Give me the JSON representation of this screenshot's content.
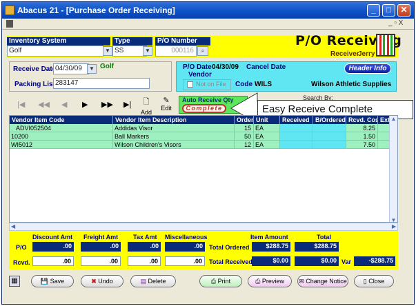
{
  "window": {
    "title": "Abacus 21 - [Purchase Order Receiving]"
  },
  "menubar": {
    "right_controls": "_ ▫ X"
  },
  "header": {
    "inventory_label": "Inventory System",
    "inventory_value": "Golf",
    "type_label": "Type",
    "type_value": "SS",
    "po_label": "P/O Number",
    "po_value": "000116",
    "heading": "P/O Receiving",
    "receiver_label": "Receiver",
    "receiver_value": "Jerry"
  },
  "receive": {
    "date_label": "Receive Date",
    "date_value": "04/30/09",
    "location": "Golf",
    "packing_label": "Packing List",
    "packing_value": "283147"
  },
  "po_info": {
    "po_date_label": "P/O Date",
    "po_date_value": "04/30/09",
    "cancel_label": "Cancel Date",
    "vendor_label": "Vendor",
    "not_on_file": "Not on File",
    "code_label": "Code",
    "code_value": "WILS",
    "vendor_name": "Wilson Athletic Supplies",
    "header_info_button": "Header Info"
  },
  "toolbar": {
    "add_label": "Add",
    "edit_label": "Edit",
    "auto_receive_label": "Auto Receive Qty",
    "complete_label": "Complete",
    "search_by_label": "Search By:",
    "callout": "Easy Receive Complete"
  },
  "grid": {
    "columns": [
      "Vendor Item Code",
      "Vendor Item Description",
      "Order",
      "Unit",
      "Received",
      "B/Ordered",
      "Rcvd. Cost",
      "Ext C"
    ],
    "rows": [
      {
        "code": "ADVI052504",
        "desc": "Addidas Visor",
        "order": "15",
        "unit": "EA",
        "received": "",
        "bordered": "",
        "cost": "8.25"
      },
      {
        "code": "10200",
        "desc": "Ball Markers",
        "order": "50",
        "unit": "EA",
        "received": "",
        "bordered": "",
        "cost": "1.50"
      },
      {
        "code": "WI5012",
        "desc": "Wilson Children's Visors",
        "order": "12",
        "unit": "EA",
        "received": "",
        "bordered": "",
        "cost": "7.50"
      }
    ]
  },
  "totals": {
    "discount_label": "Discount  Amt",
    "freight_label": "Freight Amt",
    "tax_label": "Tax Amt",
    "misc_label": "Miscellaneous",
    "item_amount_label": "Item  Amount",
    "total_label": "Total",
    "po_row_label": "P/O",
    "rcvd_row_label": "Rcvd.",
    "total_ordered_label": "Total Ordered",
    "total_received_label": "Total Received",
    "var_label": "Var",
    "po_discount": ".00",
    "po_freight": ".00",
    "po_tax": ".00",
    "po_misc": ".00",
    "po_item_amount": "$288.75",
    "po_total": "$288.75",
    "rcvd_discount": ".00",
    "rcvd_freight": ".00",
    "rcvd_tax": ".00",
    "rcvd_misc": ".00",
    "rcvd_item_amount": "$0.00",
    "rcvd_total": "$0.00",
    "variance": "-$288.75"
  },
  "actions": {
    "save": "Save",
    "undo": "Undo",
    "delete": "Delete",
    "print": "Print",
    "preview": "Preview",
    "change_notice": "Change Notice",
    "close": "Close"
  }
}
